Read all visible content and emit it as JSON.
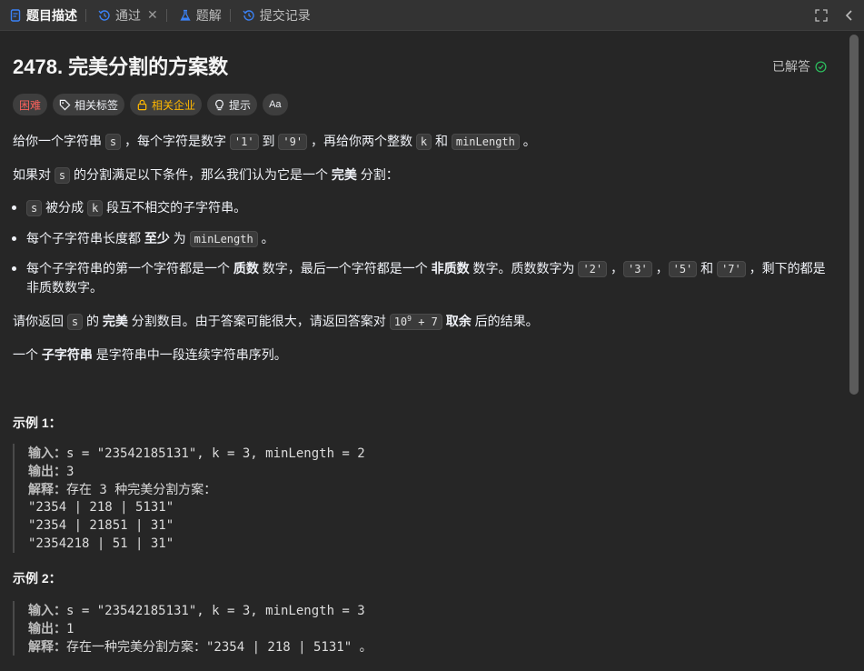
{
  "tabs": [
    {
      "label": "题目描述",
      "icon": "document-icon",
      "active": true
    },
    {
      "label": "通过",
      "icon": "history-icon",
      "closable": true
    },
    {
      "label": "题解",
      "icon": "flask-icon"
    },
    {
      "label": "提交记录",
      "icon": "history-icon"
    }
  ],
  "close_glyph": "✕",
  "problem": {
    "title": "2478. 完美分割的方案数",
    "status": "已解答",
    "tags": {
      "difficulty": "困难",
      "related_tags": "相关标签",
      "related_companies": "相关企业",
      "hint": "提示",
      "font": "Aa"
    }
  },
  "desc": {
    "p1": [
      "给你一个字符串 ",
      "s",
      " ，每个字符是数字 ",
      "'1'",
      " 到 ",
      "'9'",
      " ，再给你两个整数 ",
      "k",
      " 和 ",
      "minLength",
      " 。"
    ],
    "p2": [
      "如果对 ",
      "s",
      " 的分割满足以下条件，那么我们认为它是一个 ",
      "完美",
      " 分割："
    ],
    "li1": [
      "s",
      " 被分成 ",
      "k",
      " 段互不相交的子字符串。"
    ],
    "li2": [
      "每个子字符串长度都 ",
      "至少",
      " 为 ",
      "minLength",
      " 。"
    ],
    "li3a": [
      "每个子字符串的第一个字符都是一个 ",
      "质数",
      " 数字，最后一个字符都是一个 ",
      "非质数",
      " 数字。质数数字为 ",
      "'2'",
      " ，",
      "'3'",
      " ，",
      "'5'",
      " 和 ",
      "'7'",
      " ，剩下的都是"
    ],
    "li3b": "非质数数字。",
    "p3": [
      "请你返回 ",
      "s",
      " 的 ",
      "完美",
      " 分割数目。由于答案可能很大，请返回答案对 ",
      "10",
      "9",
      " + 7",
      " 取余",
      " 后的结果。"
    ],
    "p4": [
      "一个 ",
      "子字符串",
      " 是字符串中一段连续字符串序列。"
    ]
  },
  "examples": [
    {
      "title": "示例 1：",
      "input_label": "输入：",
      "input": "s = \"23542185131\", k = 3, minLength = 2",
      "output_label": "输出：",
      "output": "3",
      "explain_label": "解释：",
      "explain": "存在 3 种完美分割方案：",
      "lines": [
        "\"2354 | 218 | 5131\"",
        "\"2354 | 21851 | 31\"",
        "\"2354218 | 51 | 31\""
      ]
    },
    {
      "title": "示例 2：",
      "input_label": "输入：",
      "input": "s = \"23542185131\", k = 3, minLength = 3",
      "output_label": "输出：",
      "output": "1",
      "explain_label": "解释：",
      "explain": "存在一种完美分割方案：\"2354 | 218 | 5131\" 。"
    }
  ]
}
